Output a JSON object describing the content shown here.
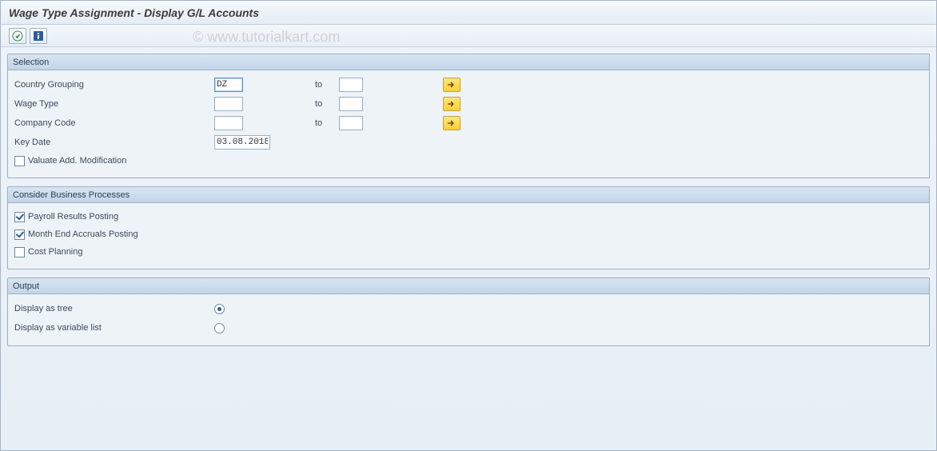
{
  "title": "Wage Type Assignment - Display G/L Accounts",
  "toolbar": {
    "execute_icon": "execute-icon",
    "info_icon": "info-icon"
  },
  "watermark": "© www.tutorialkart.com",
  "groups": {
    "selection": {
      "title": "Selection",
      "rows": {
        "country_grouping": {
          "label": "Country Grouping",
          "from": "DZ",
          "to_label": "to",
          "to": ""
        },
        "wage_type": {
          "label": "Wage Type",
          "from": "",
          "to_label": "to",
          "to": ""
        },
        "company_code": {
          "label": "Company Code",
          "from": "",
          "to_label": "to",
          "to": ""
        },
        "key_date": {
          "label": "Key Date",
          "value": "03.08.2018"
        },
        "valuate_add_mod": {
          "label": "Valuate Add. Modification",
          "checked": false
        }
      }
    },
    "processes": {
      "title": "Consider Business Processes",
      "payroll": {
        "label": "Payroll Results Posting",
        "checked": true
      },
      "accruals": {
        "label": "Month End Accruals Posting",
        "checked": true
      },
      "cost": {
        "label": "Cost Planning",
        "checked": false
      }
    },
    "output": {
      "title": "Output",
      "tree": {
        "label": "Display as tree",
        "selected": true
      },
      "list": {
        "label": "Display as variable list",
        "selected": false
      }
    }
  }
}
